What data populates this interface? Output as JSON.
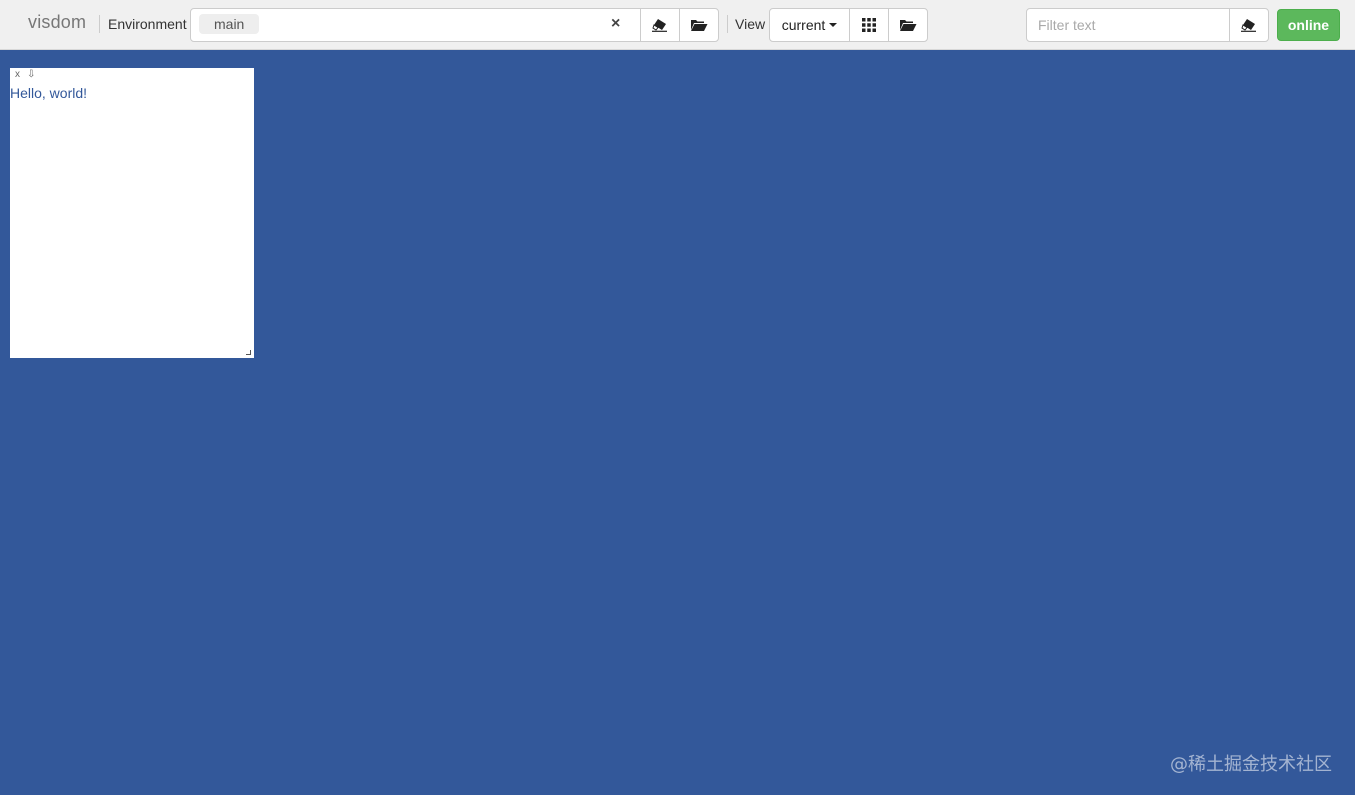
{
  "app": {
    "brand": "visdom"
  },
  "environment": {
    "label": "Environment",
    "selected_tag": "main",
    "clear_glyph": "×"
  },
  "view": {
    "label": "View",
    "selected": "current"
  },
  "filter": {
    "placeholder": "Filter text"
  },
  "status": {
    "label": "online",
    "color": "#5cb85c"
  },
  "panes": [
    {
      "close_glyph": "x",
      "download_glyph": "⇩",
      "text": "Hello, world!"
    }
  ],
  "watermark": "@稀土掘金技术社区",
  "colors": {
    "background": "#33589a",
    "navbar": "#f0f0f0"
  },
  "icons": {
    "env_clear": "eraser-icon",
    "env_open": "folder-open-icon",
    "view_grid": "grid-icon",
    "view_open": "folder-open-icon",
    "filter_clear": "eraser-icon"
  }
}
